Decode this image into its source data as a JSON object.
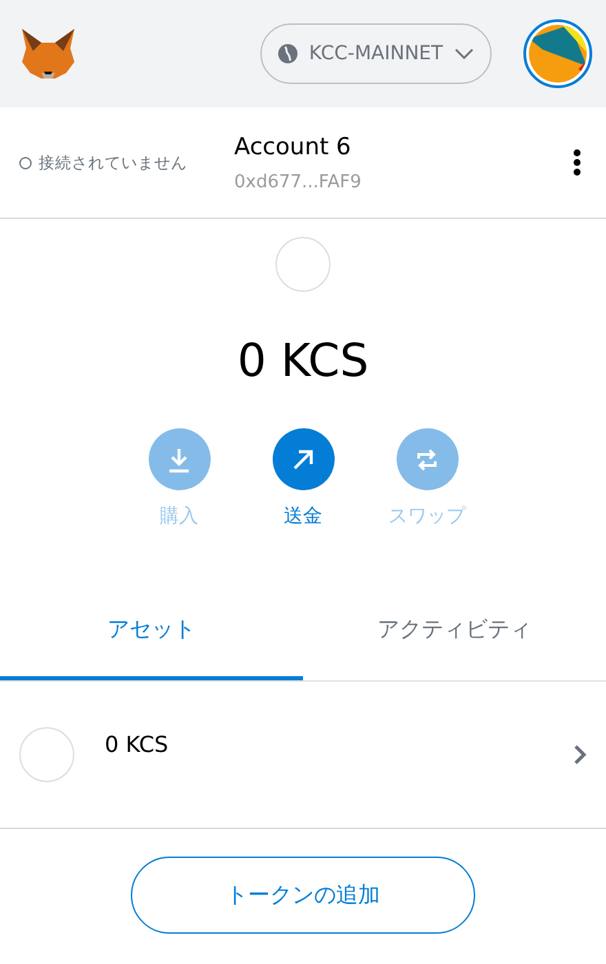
{
  "header": {
    "network": "KCC-MAINNET"
  },
  "account": {
    "connection": "接続されていません",
    "connected": false,
    "name": "Account 6",
    "address": "0xd677...FAF9"
  },
  "balance": "0 KCS",
  "actions": [
    {
      "kind": "buy",
      "label": "購入",
      "disabled": true
    },
    {
      "kind": "send",
      "label": "送金",
      "disabled": false
    },
    {
      "kind": "swap",
      "label": "スワップ",
      "disabled": true
    }
  ],
  "tabs": [
    {
      "label": "アセット",
      "selected": true
    },
    {
      "label": "アクティビティ",
      "selected": false
    }
  ],
  "assets": [
    {
      "amount": "0 KCS"
    }
  ],
  "add_token_button": "トークンの追加"
}
